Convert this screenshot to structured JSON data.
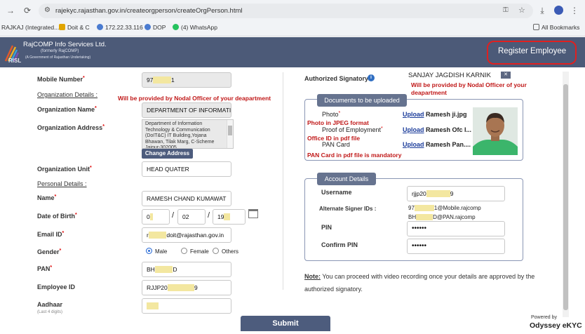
{
  "browser": {
    "url": "rajekyc.rajasthan.gov.in/createorgperson/createOrgPerson.html",
    "bookmarks": [
      "RAJKAJ (Integrated...",
      "Doit & C",
      "172.22.33.116",
      "DOP",
      "(4) WhatsApp"
    ],
    "all_bookmarks": "All Bookmarks"
  },
  "header": {
    "company": "RajCOMP Info Services Ltd.",
    "formerly": "(formerly RajCOMP)",
    "tagline": "(A Government of Rajasthan Undertaking)",
    "logo_text": "RISL",
    "register_button": "Register Employee"
  },
  "form": {
    "mobile_label": "Mobile Number",
    "mobile_value": "97",
    "mobile_value_end": "1",
    "org_details_heading": "Organization Details :",
    "nodal_note": "Will be provided by Nodal Officer of your deapartment",
    "org_name_label": "Organization Name",
    "org_name_value": "DEPARTMENT OF INFORMATIO",
    "org_address_label": "Organization Address",
    "org_address_value": "Department of Information Technology & Communication (DoIT&C) IT Building,Yojana Bhawan, Tilak Marg, C-Scheme Jaipur-302005",
    "change_address_button": "Change Address",
    "org_unit_label": "Organization Unit",
    "org_unit_value": "HEAD QUATER",
    "personal_heading": "Personal Details :",
    "name_label": "Name",
    "name_value": "RAMESH CHAND KUMAWAT",
    "dob_label": "Date of Birth",
    "dob_day": "0",
    "dob_month": "02",
    "dob_year": "19",
    "email_label": "Email ID",
    "email_prefix": "r",
    "email_value": "doit@rajasthan.gov.in",
    "gender_label": "Gender",
    "gender_options": [
      "Male",
      "Female",
      "Others"
    ],
    "pan_label": "PAN",
    "pan_prefix": "BH",
    "pan_suffix": "D",
    "employee_id_label": "Employee ID",
    "employee_id_prefix": "RJJP20",
    "employee_id_suffix": "9",
    "aadhaar_label": "Aadhaar",
    "aadhaar_hint": "(Last 4 digits)",
    "aadhaar_value": "",
    "submit_button": "Submit"
  },
  "right": {
    "auth_signatory_label": "Authorized Signatory",
    "auth_signatory_value": "SANJAY JAGDISH KARNIK",
    "nodal_note": "Will be provided by Nodal Officer of your deapartment",
    "documents_heading": "Documents to be uploaded",
    "docs": [
      {
        "label": "Photo",
        "link": "Upload",
        "file": "Ramesh ji.jpg"
      },
      {
        "label": "Proof of Employment",
        "link": "Upload",
        "file": "Ramesh Ofc I..."
      },
      {
        "label": "PAN Card",
        "link": "Upload",
        "file": "Ramesh Pan...."
      }
    ],
    "photo_note": "Photo in JPEG format",
    "office_note": "Office ID in pdf file",
    "pan_note": "PAN Card in pdf file is mandatory",
    "account_heading": "Account Details",
    "username_label": "Username",
    "username_prefix": "rjjp20",
    "username_suffix": "9",
    "alt_signer_label": "Alternate Signer IDs :",
    "alt_signer_1_prefix": "97",
    "alt_signer_1_suffix": "1@Mobile.rajcomp",
    "alt_signer_2_prefix": "BH",
    "alt_signer_2_suffix": "D@PAN.rajcomp",
    "pin_label": "PIN",
    "pin_value": "••••••",
    "confirm_pin_label": "Confirm PIN",
    "confirm_pin_value": "••••••",
    "note_label": "Note:",
    "note_text": "You can proceed with video recording once your details are approved by the authorized signatory."
  },
  "footer": {
    "powered_by": "Powered by",
    "brand": "Odyssey eKYC"
  },
  "colors": {
    "header_bg": "#4c5a78",
    "highlight_red": "#e02020",
    "note_red": "#c01818",
    "link_blue": "#1a3b9a"
  }
}
